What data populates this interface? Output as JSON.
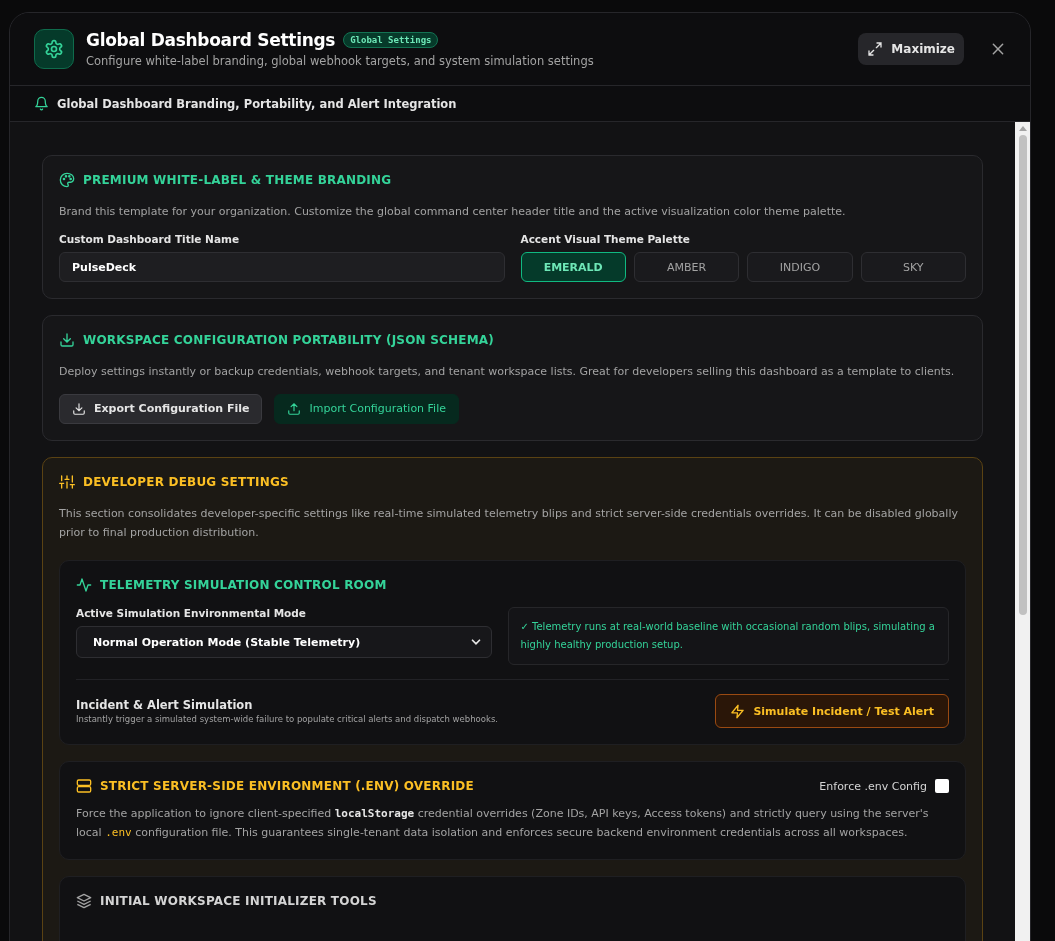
{
  "header": {
    "title": "Global Dashboard Settings",
    "badge": "Global Settings",
    "subtitle": "Configure white-label branding, global webhook targets, and system simulation settings",
    "maximize": "Maximize"
  },
  "subheader": {
    "text": "Global Dashboard Branding, Portability, and Alert Integration"
  },
  "branding": {
    "title": "PREMIUM WHITE-LABEL & THEME BRANDING",
    "description": "Brand this template for your organization. Customize the global command center header title and the active visualization color theme palette.",
    "title_label": "Custom Dashboard Title Name",
    "title_value": "PulseDeck",
    "palette_label": "Accent Visual Theme Palette",
    "themes": [
      {
        "label": "EMERALD",
        "selected": true
      },
      {
        "label": "AMBER",
        "selected": false
      },
      {
        "label": "INDIGO",
        "selected": false
      },
      {
        "label": "SKY",
        "selected": false
      }
    ]
  },
  "portability": {
    "title": "WORKSPACE CONFIGURATION PORTABILITY (JSON SCHEMA)",
    "description": "Deploy settings instantly or backup credentials, webhook targets, and tenant workspace lists. Great for developers selling this dashboard as a template to clients.",
    "export_button": "Export Configuration File",
    "import_button": "Import Configuration File"
  },
  "debug": {
    "title": "DEVELOPER DEBUG SETTINGS",
    "description": "This section consolidates developer-specific settings like real-time simulated telemetry blips and strict server-side credentials overrides. It can be disabled globally prior to final production distribution.",
    "telemetry": {
      "title": "TELEMETRY SIMULATION CONTROL ROOM",
      "mode_label": "Active Simulation Environmental Mode",
      "mode_value": "Normal Operation Mode (Stable Telemetry)",
      "status_note": "✓ Telemetry runs at real-world baseline with occasional random blips, simulating a highly healthy production setup.",
      "incident_title": "Incident & Alert Simulation",
      "incident_description": "Instantly trigger a simulated system-wide failure to populate critical alerts and dispatch webhooks.",
      "incident_button": "Simulate Incident / Test Alert"
    },
    "env_override": {
      "title": "STRICT SERVER-SIDE ENVIRONMENT (.ENV) OVERRIDE",
      "checkbox_label": "Enforce .env Config",
      "checked": false,
      "description_parts": [
        {
          "kind": "text",
          "text": "Force the application to ignore client-specified "
        },
        {
          "kind": "code",
          "text": "localStorage"
        },
        {
          "kind": "text",
          "text": " credential overrides (Zone IDs, API keys, Access tokens) and strictly query using the server's local "
        },
        {
          "kind": "code-accent",
          "text": ".env"
        },
        {
          "kind": "text",
          "text": " configuration file. This guarantees single-tenant data isolation and enforces secure backend environment credentials across all workspaces."
        }
      ]
    },
    "initializer": {
      "title": "INITIAL WORKSPACE INITIALIZER TOOLS"
    }
  }
}
